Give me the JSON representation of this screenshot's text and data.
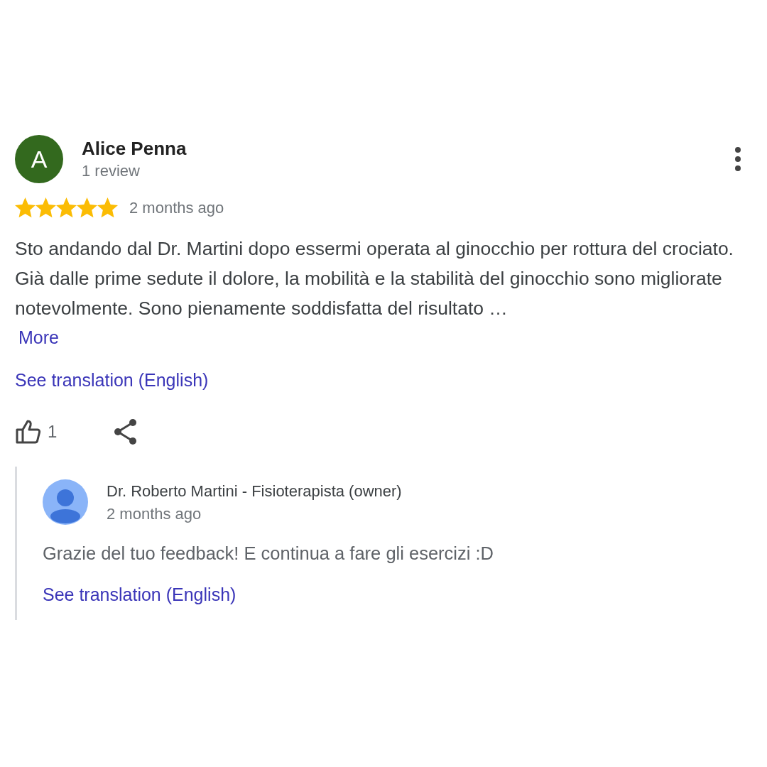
{
  "review": {
    "author": {
      "initial": "A",
      "name": "Alice Penna",
      "subtitle": "1 review",
      "color": "#33691e"
    },
    "stars": 5,
    "time": "2 months ago",
    "text": "Sto andando dal Dr. Martini dopo essermi operata al ginocchio per rottura del crociato. Già dalle prime sedute il dolore, la mobilità e la stabilità del ginocchio sono migliorate notevolmente. Sono pienamente soddisfatta del risultato …",
    "more": "More",
    "translate": "See translation (English)",
    "likes": "1"
  },
  "reply": {
    "name": "Dr. Roberto Martini - Fisioterapista (owner)",
    "time": "2 months ago",
    "text": "Grazie del tuo feedback! E continua a fare gli esercizi :D",
    "translate": "See translation (English)"
  }
}
